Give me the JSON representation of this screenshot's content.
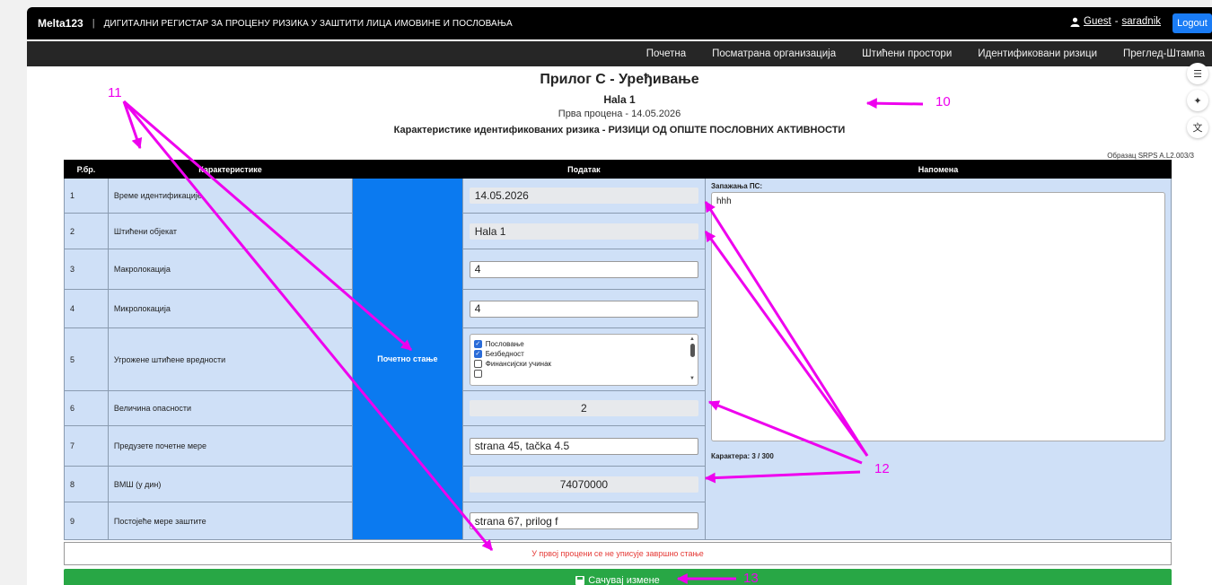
{
  "topbar": {
    "brand": "Melta123",
    "separator": "|",
    "title": "ДИГИТАЛНИ РЕГИСТАР ЗА ПРОЦЕНУ РИЗИКА У ЗАШТИТИ ЛИЦА ИМОВИНЕ И ПОСЛОВАЊА",
    "user_guest": "Guest",
    "user_dash": "-",
    "user_name": "saradnik",
    "logout": "Logout"
  },
  "nav": [
    "Почетна",
    "Посматрана организација",
    "Штићени простори",
    "Идентификовани ризици",
    "Преглед-Штампа"
  ],
  "side_icons": [
    "book-icon",
    "sparkle-icon",
    "translate-icon"
  ],
  "header": {
    "title": "Прилог С - Уређивање",
    "object": "Hala 1",
    "assessment": "Прва процена - 14.05.2026",
    "characteristics": "Карактеристике идентификованих ризика - РИЗИЦИ ОД ОПШТЕ ПОСЛОВНИХ АКТИВНОСТИ",
    "form_code": "Образац SRPS A.L2.003/3"
  },
  "table": {
    "headers": [
      "Р.бр.",
      "Карактеристике",
      "",
      "Податак",
      "Напомена"
    ],
    "mid_label": "Почетно стање",
    "rows": [
      {
        "num": "1",
        "label": "Време идентификације",
        "value": "14.05.2026"
      },
      {
        "num": "2",
        "label": "Штићени објекат",
        "value": "Hala 1"
      },
      {
        "num": "3",
        "label": "Макролокација",
        "value": "4"
      },
      {
        "num": "4",
        "label": "Микролокација",
        "value": "4"
      },
      {
        "num": "5",
        "label": "Угрожене штићене вредности",
        "value": ""
      },
      {
        "num": "6",
        "label": "Величина опасности",
        "value": "2"
      },
      {
        "num": "7",
        "label": "Предузете почетне мере",
        "value": "strana 45, tačka 4.5"
      },
      {
        "num": "8",
        "label": "ВМШ (у дин)",
        "value": "74070000"
      },
      {
        "num": "9",
        "label": "Постојеће мере заштите",
        "value": "strana 67, prilog f"
      }
    ],
    "multiselect_options": [
      {
        "label": "Пословање",
        "checked": true
      },
      {
        "label": "Безбедност",
        "checked": true
      },
      {
        "label": "Финансијски учинак",
        "checked": false
      }
    ],
    "note_label": "Запажања ПС:",
    "note_text": "hhh",
    "note_counter": "Карактера: 3 / 300"
  },
  "final_message": "У првој процени се не уписује завршно стање",
  "save_button": "Сачувај измене",
  "annotations": {
    "color": "#ee00ee",
    "labels": [
      "10",
      "11",
      "12",
      "13"
    ]
  }
}
